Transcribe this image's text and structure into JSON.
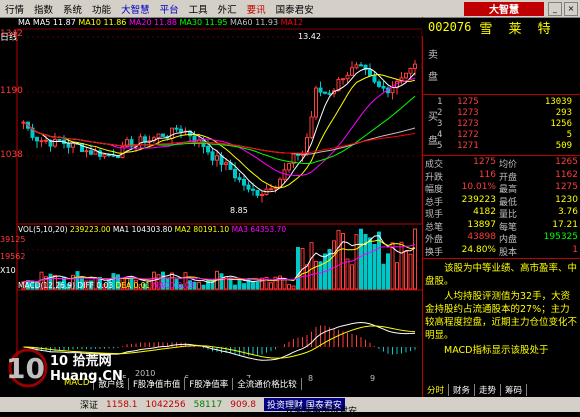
{
  "menubar": {
    "items": [
      "行情",
      "指数",
      "系统",
      "功能",
      "大智慧",
      "平台",
      "工具",
      "外汇",
      "要讯",
      "国泰君安"
    ],
    "logo": "大智慧"
  },
  "left_label": "日线",
  "ma_legend": {
    "ma": "MA",
    "ma5": "MA5 11.87",
    "ma10": "MA10 11.86",
    "ma20": "MA20 11.88",
    "ma30": "MA30 11.95",
    "ma60": "MA60 11.93",
    "ma120": "MA12"
  },
  "price_axis": [
    "1342",
    "1190",
    "1038"
  ],
  "chart_annotations": {
    "high": "13.42",
    "low": "8.85"
  },
  "vol_legend": {
    "vol": "VOL(5,10,20)",
    "v": "239223.00",
    "ma1": "MA1 104303.80",
    "ma2": "MA2 80191.10",
    "ma3": "MA3 64353.70"
  },
  "vol_axis": [
    "39125",
    "19562",
    "X10"
  ],
  "macd_legend": {
    "label": "MACD(12,26,9)",
    "diff": "DIFF 0.03",
    "dea": "DEA 0.01",
    "macd": "MACD 0.03"
  },
  "x_axis": {
    "year": "2010",
    "ticks": [
      "4",
      "5",
      "6",
      "7",
      "8",
      "9"
    ]
  },
  "stock": {
    "code": "002076",
    "name": "雪 莱 特"
  },
  "order_book": {
    "sell_label": "卖",
    "sell_label2": "盘",
    "buy_label": "买",
    "buy_label2": "盘",
    "rows": [
      {
        "price": "1275",
        "vol": "13039"
      },
      {
        "price": "1273",
        "vol": "293"
      },
      {
        "price": "1273",
        "vol": "1256"
      },
      {
        "price": "1272",
        "vol": "5"
      },
      {
        "price": "1271",
        "vol": "509"
      }
    ]
  },
  "stats": [
    {
      "l1": "成交",
      "v1": "1275",
      "l2": "均价",
      "v2": "1265"
    },
    {
      "l1": "升跌",
      "v1": "116",
      "l2": "开盘",
      "v2": "1162"
    },
    {
      "l1": "幅度",
      "v1": "10.01%",
      "l2": "最高",
      "v2": "1275"
    },
    {
      "l1": "总手",
      "v1": "239223",
      "l2": "最低",
      "v2": "1230"
    },
    {
      "l1": "现手",
      "v1": "4182",
      "l2": "量比",
      "v2": "3.76"
    },
    {
      "l1": "总笔",
      "v1": "13897",
      "l2": "每笔",
      "v2": "17.21"
    },
    {
      "l1": "外盘",
      "v1": "43898",
      "l2": "内盘",
      "v2": "195325"
    },
    {
      "l1": "换手",
      "v1": "24.80%",
      "l2": "股本",
      "v2": "1"
    }
  ],
  "comment": [
    "该股为中等业绩、高市盈率、中盘股。",
    "人均持股评测值为32手，大资金持股约占流通股本的27%；主力较高程度控盘，近期主力仓位变化不明显。",
    "MACD指标显示该股处于"
  ],
  "bottom_tabs": [
    "MACD",
    "散户线",
    "F股净值市值",
    "F股净值率",
    "全流通价格比较"
  ],
  "right_tabs": [
    "分时",
    "财务",
    "走势",
    "筹码"
  ],
  "status": {
    "index": "深证",
    "a": "1158.1",
    "b": "1042256",
    "c": "58117",
    "d": "909.8",
    "broker": "投资理财 国泰君安",
    "welcome": "欢迎使用国泰君安"
  },
  "watermark": "10 拾荒网 Huang.CN",
  "colors": {
    "up": "#ff3c3c",
    "down": "#00c8c8",
    "ma5": "#ffffff",
    "ma10": "#ffff00",
    "ma20": "#ff00ff",
    "ma30": "#00ff00",
    "ma60": "#c0c0c0",
    "ma120": "#ff0000"
  }
}
